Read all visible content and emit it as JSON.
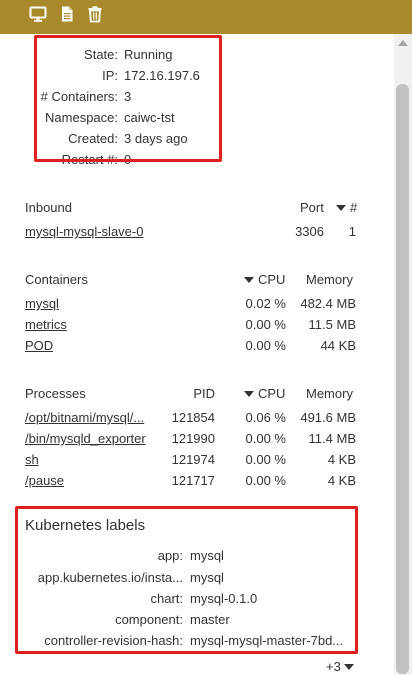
{
  "toolbar": {
    "icons": [
      "monitor-icon",
      "document-icon",
      "trash-icon"
    ],
    "color": "#a88a2c"
  },
  "summary": {
    "state_label": "State:",
    "state_value": "Running",
    "ip_label": "IP:",
    "ip_value": "172.16.197.6",
    "containers_label": "# Containers:",
    "containers_value": "3",
    "namespace_label": "Namespace:",
    "namespace_value": "caiwc-tst",
    "created_label": "Created:",
    "created_value": "3 days ago",
    "restart_label": "Restart #:",
    "restart_value": "0"
  },
  "inbound": {
    "title": "Inbound",
    "col_port": "Port",
    "col_count": "#",
    "rows": [
      {
        "name": "mysql-mysql-slave-0",
        "port": "3306",
        "count": "1"
      }
    ]
  },
  "containers": {
    "title": "Containers",
    "col_cpu": "CPU",
    "col_memory": "Memory",
    "rows": [
      {
        "name": "mysql",
        "cpu": "0.02 %",
        "memory": "482.4 MB"
      },
      {
        "name": "metrics",
        "cpu": "0.00 %",
        "memory": "11.5 MB"
      },
      {
        "name": "POD",
        "cpu": "0.00 %",
        "memory": "44 KB"
      }
    ]
  },
  "processes": {
    "title": "Processes",
    "col_pid": "PID",
    "col_cpu": "CPU",
    "col_memory": "Memory",
    "rows": [
      {
        "name": "/opt/bitnami/mysql/...",
        "pid": "121854",
        "cpu": "0.06 %",
        "memory": "491.6 MB"
      },
      {
        "name": "/bin/mysqld_exporter",
        "pid": "121990",
        "cpu": "0.00 %",
        "memory": "11.4 MB"
      },
      {
        "name": "sh",
        "pid": "121974",
        "cpu": "0.00 %",
        "memory": "4 KB"
      },
      {
        "name": "/pause",
        "pid": "121717",
        "cpu": "0.00 %",
        "memory": "4 KB"
      }
    ]
  },
  "k8s_labels": {
    "title": "Kubernetes labels",
    "rows": [
      {
        "key": "app:",
        "value": "mysql"
      },
      {
        "key": "app.kubernetes.io/insta...",
        "value": "mysql"
      },
      {
        "key": "chart:",
        "value": "mysql-0.1.0"
      },
      {
        "key": "component:",
        "value": "master"
      },
      {
        "key": "controller-revision-hash:",
        "value": "mysql-mysql-master-7bd..."
      }
    ],
    "more_label": "+3"
  },
  "highlight_color": "#e02020"
}
